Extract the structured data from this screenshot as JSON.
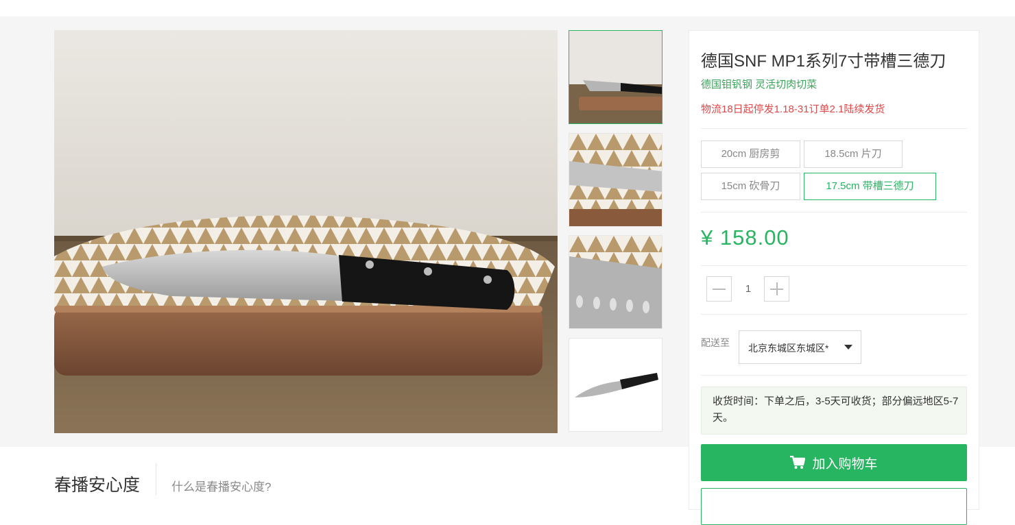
{
  "gallery": {
    "thumbnails": [
      "thumb-1",
      "thumb-2",
      "thumb-3",
      "thumb-4"
    ],
    "active_thumbnail": 1
  },
  "product": {
    "title": "德国SNF MP1系列7寸带槽三德刀",
    "subtitle": "德国钼钒钢 灵活切肉切菜",
    "notice": "物流18日起停发1.18-31订单2.1陆续发货"
  },
  "specs": [
    {
      "label": "20cm 厨房剪",
      "selected": false
    },
    {
      "label": "18.5cm 片刀",
      "selected": false
    },
    {
      "label": "15cm 砍骨刀",
      "selected": false
    },
    {
      "label": "17.5cm 带槽三德刀",
      "selected": true
    }
  ],
  "price": {
    "display": "¥ 158.00",
    "value": 158.0,
    "currency": "¥"
  },
  "quantity": {
    "value": "1",
    "decrease_icon": "minus-icon",
    "increase_icon": "plus-icon"
  },
  "shipping": {
    "label": "配送至",
    "region": "北京东城区东城区*",
    "delivery_note": "收货时间：下单之后，3-5天可收货；部分偏远地区5-7天。"
  },
  "actions": {
    "add_to_cart": "加入购物车",
    "cart_icon": "cart-icon"
  },
  "section": {
    "title": "春播安心度",
    "link": "什么是春播安心度?"
  },
  "colors": {
    "accent": "#27b561",
    "notice": "#e04848",
    "subtitle": "#3aa35a",
    "page_bg": "#f5f5f5"
  }
}
